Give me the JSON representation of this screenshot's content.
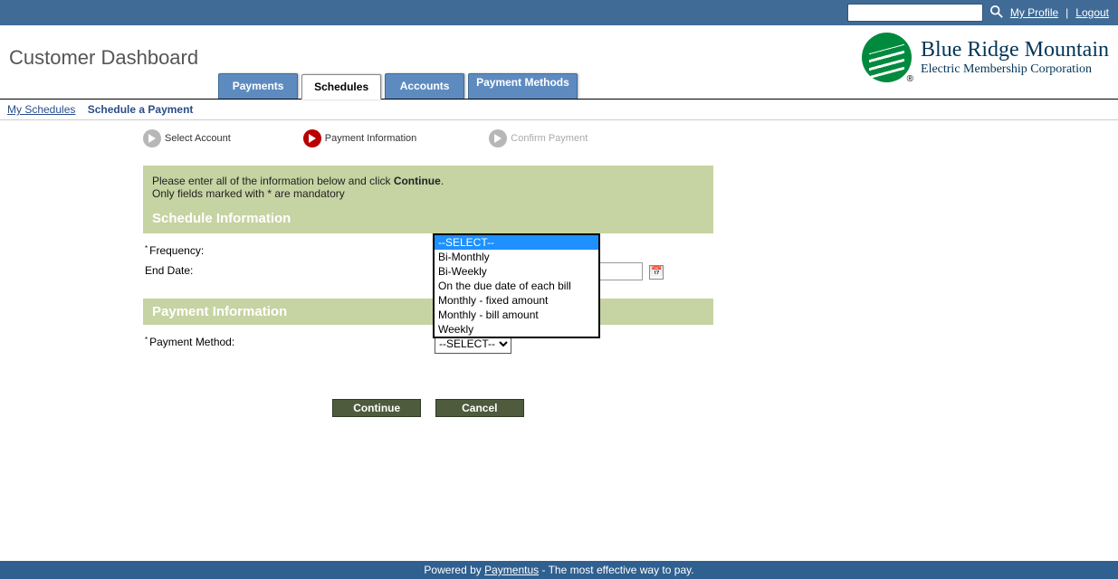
{
  "topbar": {
    "search_placeholder": "",
    "links": {
      "profile": "My Profile",
      "logout": "Logout"
    }
  },
  "header": {
    "title": "Customer Dashboard",
    "tabs": [
      "Payments",
      "Schedules",
      "Accounts",
      "Payment Methods"
    ],
    "active_tab_index": 1,
    "brand_name": "Blue Ridge Mountain",
    "brand_sub": "Electric Membership Corporation"
  },
  "subnav": {
    "link": "My Schedules",
    "current": "Schedule a Payment"
  },
  "wizard": {
    "steps": [
      "Select Account",
      "Payment Information",
      "Confirm Payment"
    ],
    "active_index": 1
  },
  "info": {
    "line1_a": "Please enter all of the information below and click ",
    "line1_b": "Continue",
    "line1_c": ".",
    "line2": "Only fields marked with * are mandatory",
    "section1": "Schedule Information",
    "section2": "Payment Information"
  },
  "form": {
    "frequency_label": "Frequency:",
    "end_date_label": "End Date:",
    "end_date_value": "",
    "frequency_options": [
      "--SELECT--",
      "Bi-Monthly",
      "Bi-Weekly",
      "On the due date of each bill",
      "Monthly - fixed amount",
      "Monthly - bill amount",
      "Weekly"
    ],
    "frequency_selected_index": 0,
    "payment_method_label": "Payment Method:",
    "payment_method_value": "--SELECT--"
  },
  "buttons": {
    "continue": "Continue",
    "cancel": "Cancel"
  },
  "footer": {
    "prefix": "Powered by ",
    "link": "Paymentus",
    "suffix": " - The most effective way to pay."
  }
}
